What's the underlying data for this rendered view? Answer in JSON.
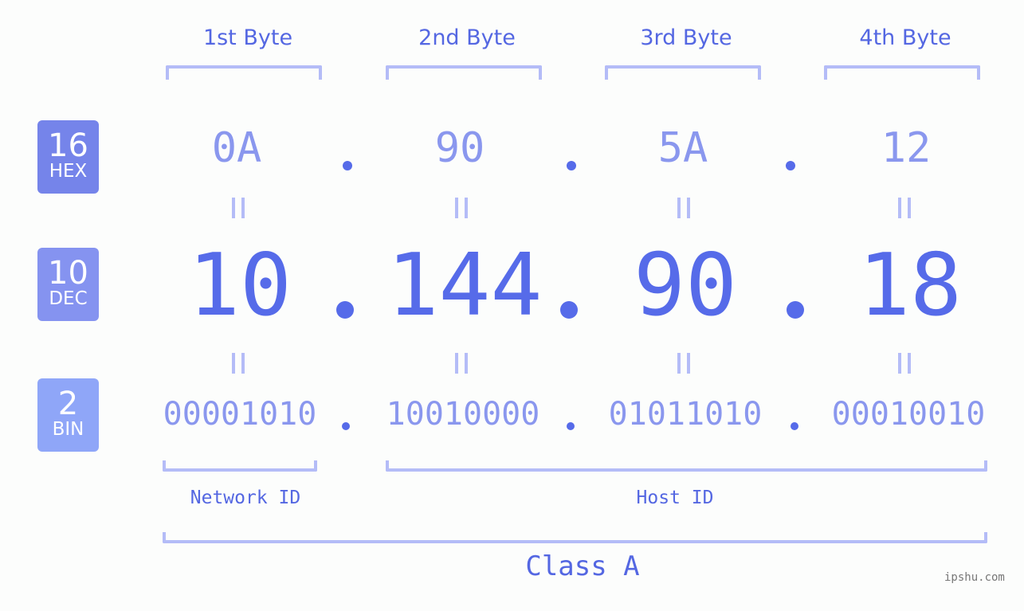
{
  "headers": [
    "1st Byte",
    "2nd Byte",
    "3rd Byte",
    "4th Byte"
  ],
  "badges": {
    "hex": {
      "num": "16",
      "label": "HEX",
      "color": "#7584ea"
    },
    "dec": {
      "num": "10",
      "label": "DEC",
      "color": "#8593f0"
    },
    "bin": {
      "num": "2",
      "label": "BIN",
      "color": "#8fa6f8"
    }
  },
  "hex": [
    "0A",
    "90",
    "5A",
    "12"
  ],
  "dec": [
    "10",
    "144",
    "90",
    "18"
  ],
  "bin": [
    "00001010",
    "10010000",
    "01011010",
    "00010010"
  ],
  "network_label": "Network ID",
  "host_label": "Host ID",
  "class_label": "Class A",
  "watermark": "ipshu.com",
  "colors": {
    "accent": "#566be9",
    "light": "#8a97ee",
    "bracket": "#b4bcf7"
  }
}
